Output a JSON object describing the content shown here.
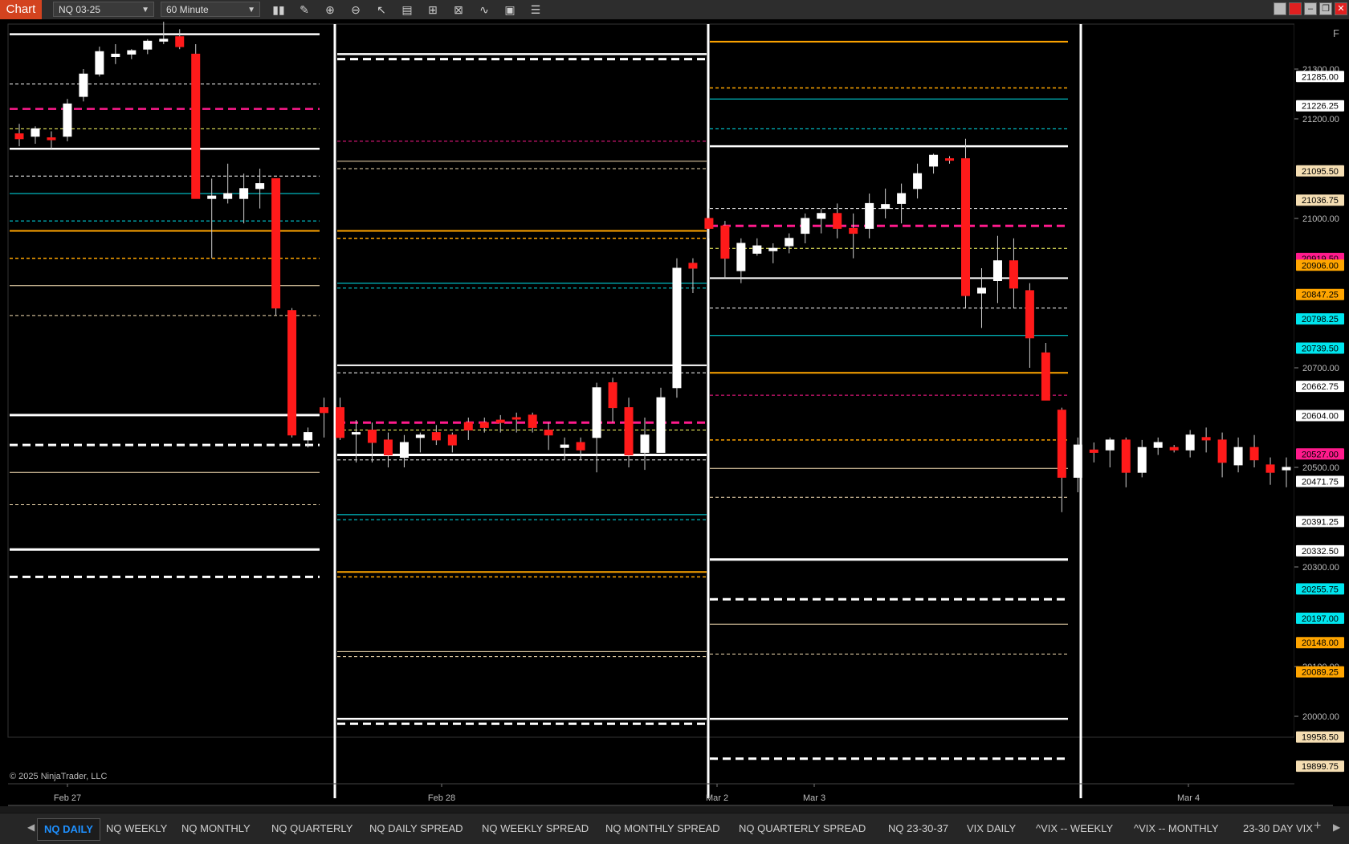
{
  "window": {
    "title": "Chart"
  },
  "toolbar": {
    "instrument": "NQ 03-25",
    "interval": "60 Minute",
    "icons": [
      "bar-type-icon",
      "draw-pencil-icon",
      "zoom-in-icon",
      "zoom-out-icon",
      "pointer-icon",
      "data-box-icon",
      "properties-icon",
      "strategies-icon",
      "indicators-icon",
      "templates-icon",
      "chart-list-icon"
    ]
  },
  "chart": {
    "copyright": "© 2025 NinjaTrader, LLC",
    "panel_button": "F",
    "date_labels": [
      "Feb 27",
      "Feb 28",
      "Mar 2",
      "Mar 3",
      "Mar 4"
    ],
    "axis_ticks": [
      "21300.00",
      "21200.00",
      "21000.00",
      "20700.00",
      "20500.00",
      "20300.00",
      "20100.00",
      "20000.00"
    ],
    "price_badges": [
      {
        "text": "21285.00",
        "color": "#ffffff",
        "value": 21285.0
      },
      {
        "text": "21226.25",
        "color": "#ffffff",
        "value": 21226.25
      },
      {
        "text": "21095.50",
        "color": "#f5deb3",
        "value": 21095.5
      },
      {
        "text": "21036.75",
        "color": "#f5deb3",
        "value": 21036.75
      },
      {
        "text": "20919.50",
        "color": "#ff1a8c",
        "value": 20919.5
      },
      {
        "text": "20906.00",
        "color": "#ffa500",
        "value": 20906.0
      },
      {
        "text": "20847.25",
        "color": "#ffa500",
        "value": 20847.25
      },
      {
        "text": "20798.25",
        "color": "#00e5ee",
        "value": 20798.25
      },
      {
        "text": "20739.50",
        "color": "#00e5ee",
        "value": 20739.5
      },
      {
        "text": "20662.75",
        "color": "#ffffff",
        "value": 20662.75
      },
      {
        "text": "20604.00",
        "color": "#ffffff",
        "value": 20604.0
      },
      {
        "text": "20527.00",
        "color": "#ff1a8c",
        "value": 20527.0
      },
      {
        "text": "20471.75",
        "color": "#ffffff",
        "value": 20471.75
      },
      {
        "text": "20391.25",
        "color": "#ffffff",
        "value": 20391.25
      },
      {
        "text": "20332.50",
        "color": "#ffffff",
        "value": 20332.5
      },
      {
        "text": "20255.75",
        "color": "#00e5ee",
        "value": 20255.75
      },
      {
        "text": "20197.00",
        "color": "#00e5ee",
        "value": 20197.0
      },
      {
        "text": "20148.00",
        "color": "#ffa500",
        "value": 20148.0
      },
      {
        "text": "20089.25",
        "color": "#ffa500",
        "value": 20089.25
      },
      {
        "text": "19958.50",
        "color": "#f5deb3",
        "value": 19958.5
      },
      {
        "text": "19899.75",
        "color": "#f5deb3",
        "value": 19899.75
      }
    ],
    "candles": [
      [
        21170,
        21190,
        21145,
        21160
      ],
      [
        21165,
        21185,
        21150,
        21180
      ],
      [
        21162,
        21175,
        21140,
        21158
      ],
      [
        21165,
        21240,
        21155,
        21230
      ],
      [
        21245,
        21300,
        21235,
        21290
      ],
      [
        21290,
        21345,
        21285,
        21335
      ],
      [
        21325,
        21350,
        21310,
        21330
      ],
      [
        21330,
        21340,
        21320,
        21337
      ],
      [
        21340,
        21360,
        21330,
        21356
      ],
      [
        21356,
        21395,
        21350,
        21360
      ],
      [
        21365,
        21380,
        21340,
        21345
      ],
      [
        21330,
        21350,
        21040,
        21040
      ],
      [
        21040,
        21080,
        20920,
        21045
      ],
      [
        21040,
        21110,
        21030,
        21050
      ],
      [
        21040,
        21090,
        20990,
        21060
      ],
      [
        21060,
        21100,
        21020,
        21070
      ],
      [
        21080,
        21080,
        20805,
        20820
      ],
      [
        20815,
        20820,
        20560,
        20565
      ],
      [
        20555,
        20580,
        20540,
        20570
      ],
      [
        20620,
        20640,
        20560,
        20610
      ],
      [
        20620,
        20640,
        20555,
        20560
      ],
      [
        20570,
        20595,
        20510,
        20570
      ],
      [
        20575,
        20590,
        20510,
        20550
      ],
      [
        20555,
        20570,
        20500,
        20525
      ],
      [
        20520,
        20565,
        20500,
        20550
      ],
      [
        20560,
        20570,
        20530,
        20565
      ],
      [
        20570,
        20585,
        20545,
        20555
      ],
      [
        20565,
        20570,
        20530,
        20545
      ],
      [
        20590,
        20600,
        20555,
        20575
      ],
      [
        20590,
        20600,
        20570,
        20580
      ],
      [
        20595,
        20605,
        20570,
        20590
      ],
      [
        20600,
        20610,
        20570,
        20597
      ],
      [
        20605,
        20610,
        20570,
        20580
      ],
      [
        20575,
        20590,
        20535,
        20565
      ],
      [
        20540,
        20560,
        20515,
        20545
      ],
      [
        20550,
        20560,
        20515,
        20535
      ],
      [
        20560,
        20670,
        20490,
        20660
      ],
      [
        20670,
        20680,
        20590,
        20620
      ],
      [
        20620,
        20640,
        20500,
        20525
      ],
      [
        20530,
        20600,
        20495,
        20565
      ],
      [
        20530,
        20660,
        20530,
        20640
      ],
      [
        20660,
        20920,
        20640,
        20900
      ],
      [
        20910,
        20920,
        20850,
        20900
      ],
      [
        21000,
        21020,
        20960,
        20980
      ],
      [
        20985,
        20995,
        20880,
        20920
      ],
      [
        20895,
        20960,
        20870,
        20950
      ],
      [
        20930,
        20960,
        20925,
        20945
      ],
      [
        20935,
        20950,
        20910,
        20940
      ],
      [
        20945,
        20970,
        20930,
        20960
      ],
      [
        20970,
        21010,
        20950,
        21000
      ],
      [
        21000,
        21020,
        20970,
        21010
      ],
      [
        21010,
        21030,
        20960,
        20980
      ],
      [
        20980,
        21010,
        20920,
        20970
      ],
      [
        20980,
        21050,
        20960,
        21030
      ],
      [
        21020,
        21060,
        21000,
        21028
      ],
      [
        21030,
        21070,
        20990,
        21050
      ],
      [
        21060,
        21110,
        21040,
        21090
      ],
      [
        21105,
        21130,
        21090,
        21127
      ],
      [
        21120,
        21125,
        21110,
        21118
      ],
      [
        21120,
        21160,
        20820,
        20845
      ],
      [
        20850,
        20900,
        20780,
        20860
      ],
      [
        20875,
        20965,
        20830,
        20915
      ],
      [
        20915,
        20960,
        20820,
        20860
      ],
      [
        20855,
        20870,
        20700,
        20760
      ],
      [
        20730,
        20750,
        20640,
        20635
      ],
      [
        20615,
        20620,
        20410,
        20480
      ],
      [
        20480,
        20560,
        20450,
        20545
      ],
      [
        20535,
        20550,
        20510,
        20530
      ],
      [
        20535,
        20560,
        20500,
        20555
      ],
      [
        20555,
        20560,
        20460,
        20490
      ],
      [
        20490,
        20555,
        20480,
        20540
      ],
      [
        20540,
        20560,
        20525,
        20550
      ],
      [
        20540,
        20545,
        20530,
        20535
      ],
      [
        20535,
        20575,
        20520,
        20565
      ],
      [
        20560,
        20580,
        20530,
        20555
      ],
      [
        20555,
        20570,
        20480,
        20510
      ],
      [
        20505,
        20560,
        20490,
        20540
      ],
      [
        20540,
        20565,
        20500,
        20515
      ],
      [
        20505,
        20520,
        20465,
        20490
      ],
      [
        20495,
        20520,
        20460,
        20500
      ]
    ],
    "levels": {
      "day1": [
        {
          "value": 21370,
          "color": "#ffffff",
          "dash": false,
          "w": 2.5
        },
        {
          "value": 21270,
          "color": "#ffffff",
          "dash": true,
          "w": 1
        },
        {
          "value": 21220,
          "color": "#ff1a8c",
          "dash": true,
          "w": 2.5
        },
        {
          "value": 21180,
          "color": "#ffff66",
          "dash": true,
          "w": 1
        },
        {
          "value": 21140,
          "color": "#ffffff",
          "dash": false,
          "w": 2.5
        },
        {
          "value": 21085,
          "color": "#ffffff",
          "dash": true,
          "w": 1
        },
        {
          "value": 21050,
          "color": "#00e5ee",
          "dash": false,
          "w": 1
        },
        {
          "value": 20995,
          "color": "#00e5ee",
          "dash": true,
          "w": 1
        },
        {
          "value": 20975,
          "color": "#ffa500",
          "dash": false,
          "w": 2
        },
        {
          "value": 20920,
          "color": "#ffa500",
          "dash": true,
          "w": 1.5
        },
        {
          "value": 20865,
          "color": "#f5deb3",
          "dash": false,
          "w": 1
        },
        {
          "value": 20805,
          "color": "#f5deb3",
          "dash": true,
          "w": 1
        },
        {
          "value": 20605,
          "color": "#ffffff",
          "dash": false,
          "w": 3
        },
        {
          "value": 20545,
          "color": "#ffffff",
          "dash": true,
          "w": 3
        },
        {
          "value": 20490,
          "color": "#f5deb3",
          "dash": false,
          "w": 1
        },
        {
          "value": 20425,
          "color": "#f5deb3",
          "dash": true,
          "w": 1
        },
        {
          "value": 20335,
          "color": "#ffffff",
          "dash": false,
          "w": 3
        },
        {
          "value": 20280,
          "color": "#ffffff",
          "dash": true,
          "w": 3
        }
      ],
      "day2": [
        {
          "value": 21330,
          "color": "#ffffff",
          "dash": false,
          "w": 2.5
        },
        {
          "value": 21320,
          "color": "#ffffff",
          "dash": true,
          "w": 3
        },
        {
          "value": 21155,
          "color": "#ff1a8c",
          "dash": true,
          "w": 1
        },
        {
          "value": 21115,
          "color": "#f5deb3",
          "dash": false,
          "w": 1
        },
        {
          "value": 21100,
          "color": "#f5deb3",
          "dash": true,
          "w": 1
        },
        {
          "value": 20975,
          "color": "#ffa500",
          "dash": false,
          "w": 2
        },
        {
          "value": 20960,
          "color": "#ffa500",
          "dash": true,
          "w": 1.5
        },
        {
          "value": 20870,
          "color": "#00e5ee",
          "dash": false,
          "w": 1
        },
        {
          "value": 20860,
          "color": "#00e5ee",
          "dash": true,
          "w": 1
        },
        {
          "value": 20705,
          "color": "#ffffff",
          "dash": false,
          "w": 2
        },
        {
          "value": 20690,
          "color": "#ffffff",
          "dash": true,
          "w": 1
        },
        {
          "value": 20590,
          "color": "#ff1a8c",
          "dash": true,
          "w": 3
        },
        {
          "value": 20575,
          "color": "#ffff66",
          "dash": true,
          "w": 1
        },
        {
          "value": 20525,
          "color": "#ffffff",
          "dash": false,
          "w": 3
        },
        {
          "value": 20515,
          "color": "#ffffff",
          "dash": true,
          "w": 1
        },
        {
          "value": 20405,
          "color": "#00e5ee",
          "dash": false,
          "w": 1
        },
        {
          "value": 20395,
          "color": "#00e5ee",
          "dash": true,
          "w": 1
        },
        {
          "value": 20290,
          "color": "#ffa500",
          "dash": false,
          "w": 2
        },
        {
          "value": 20280,
          "color": "#ffa500",
          "dash": true,
          "w": 1.5
        },
        {
          "value": 20130,
          "color": "#f5deb3",
          "dash": false,
          "w": 1
        },
        {
          "value": 20120,
          "color": "#f5deb3",
          "dash": true,
          "w": 1
        },
        {
          "value": 19995,
          "color": "#ffffff",
          "dash": false,
          "w": 2.5
        },
        {
          "value": 19985,
          "color": "#ffffff",
          "dash": true,
          "w": 3
        }
      ],
      "day3": [
        {
          "value": 21355,
          "color": "#ffa500",
          "dash": false,
          "w": 2
        },
        {
          "value": 21262,
          "color": "#ffa500",
          "dash": true,
          "w": 1.5
        },
        {
          "value": 21240,
          "color": "#00e5ee",
          "dash": false,
          "w": 1
        },
        {
          "value": 21180,
          "color": "#00e5ee",
          "dash": true,
          "w": 1
        },
        {
          "value": 21145,
          "color": "#ffffff",
          "dash": false,
          "w": 2.5
        },
        {
          "value": 21020,
          "color": "#ffffff",
          "dash": true,
          "w": 1
        },
        {
          "value": 20985,
          "color": "#ff1a8c",
          "dash": true,
          "w": 3
        },
        {
          "value": 20940,
          "color": "#ffff66",
          "dash": true,
          "w": 1
        },
        {
          "value": 20880,
          "color": "#ffffff",
          "dash": false,
          "w": 2
        },
        {
          "value": 20820,
          "color": "#ffffff",
          "dash": true,
          "w": 1
        },
        {
          "value": 20765,
          "color": "#00e5ee",
          "dash": false,
          "w": 1
        },
        {
          "value": 20690,
          "color": "#ffa500",
          "dash": false,
          "w": 2
        },
        {
          "value": 20645,
          "color": "#ff1a8c",
          "dash": true,
          "w": 1
        },
        {
          "value": 20555,
          "color": "#ffa500",
          "dash": true,
          "w": 1.5
        },
        {
          "value": 20498,
          "color": "#f5deb3",
          "dash": false,
          "w": 1
        },
        {
          "value": 20440,
          "color": "#f5deb3",
          "dash": true,
          "w": 1
        },
        {
          "value": 20315,
          "color": "#ffffff",
          "dash": false,
          "w": 3
        },
        {
          "value": 20235,
          "color": "#ffffff",
          "dash": true,
          "w": 3
        },
        {
          "value": 20185,
          "color": "#f5deb3",
          "dash": false,
          "w": 1
        },
        {
          "value": 20125,
          "color": "#f5deb3",
          "dash": true,
          "w": 1
        },
        {
          "value": 19995,
          "color": "#ffffff",
          "dash": false,
          "w": 2.5
        },
        {
          "value": 19915,
          "color": "#ffffff",
          "dash": true,
          "w": 3
        }
      ]
    }
  },
  "tabs": {
    "items": [
      "NQ DAILY",
      "NQ WEEKLY",
      "NQ MONTHLY",
      "NQ QUARTERLY",
      "NQ DAILY SPREAD",
      "NQ WEEKLY SPREAD",
      "NQ MONTHLY SPREAD",
      "NQ QUARTERLY SPREAD",
      "NQ 23-30-37",
      "VIX DAILY",
      "^VIX -- WEEKLY",
      "^VIX -- MONTHLY",
      "23-30 DAY VIX"
    ],
    "active": "NQ DAILY",
    "add_label": "+"
  }
}
